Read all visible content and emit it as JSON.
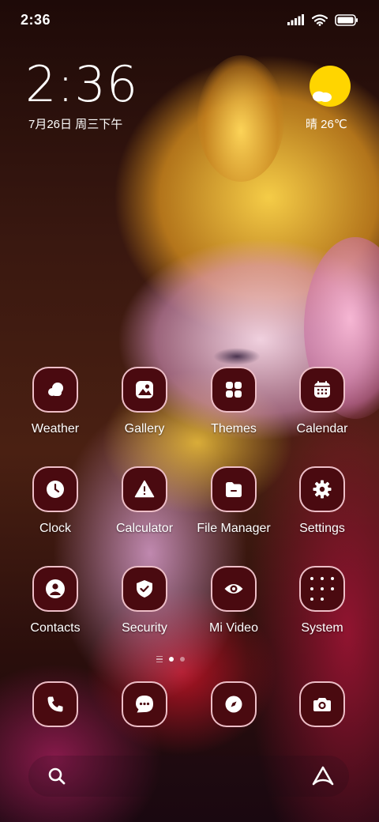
{
  "status_bar": {
    "time": "2:36",
    "icons": [
      "signal-icon",
      "wifi-icon",
      "battery-icon"
    ]
  },
  "clock_widget": {
    "time": "2:36",
    "date": "7月26日 周三下午"
  },
  "weather_widget": {
    "icon": "partly-sunny-icon",
    "text": "晴 26℃",
    "sun_color": "#FFD500"
  },
  "apps": [
    {
      "label": "Weather",
      "icon": "weather-icon"
    },
    {
      "label": "Gallery",
      "icon": "gallery-icon"
    },
    {
      "label": "Themes",
      "icon": "themes-icon"
    },
    {
      "label": "Calendar",
      "icon": "calendar-icon"
    },
    {
      "label": "Clock",
      "icon": "clock-icon"
    },
    {
      "label": "Calculator",
      "icon": "calculator-icon"
    },
    {
      "label": "File Manager",
      "icon": "file-manager-icon"
    },
    {
      "label": "Settings",
      "icon": "gear-icon"
    },
    {
      "label": "Contacts",
      "icon": "contacts-icon"
    },
    {
      "label": "Security",
      "icon": "security-shield-icon"
    },
    {
      "label": "Mi Video",
      "icon": "video-eye-icon"
    },
    {
      "label": "System",
      "icon": "system-folder-icon"
    }
  ],
  "page_indicator": {
    "pages": 2,
    "active_page": 1
  },
  "dock": [
    {
      "name": "phone",
      "icon": "phone-icon"
    },
    {
      "name": "messages",
      "icon": "message-icon"
    },
    {
      "name": "browser",
      "icon": "compass-icon"
    },
    {
      "name": "camera",
      "icon": "camera-icon"
    }
  ],
  "search_bar": {
    "icons": [
      "search-icon",
      "assistant-icon"
    ]
  },
  "theme": {
    "icon_bg": "#4A0A10",
    "icon_border": "#FFD2DC",
    "text": "#FFFFFF"
  }
}
